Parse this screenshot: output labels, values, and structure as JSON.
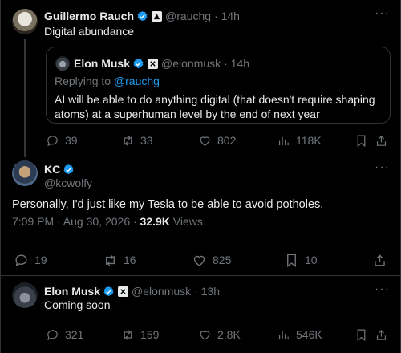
{
  "post1": {
    "name": "Guillermo Rauch",
    "handle": "@rauchg",
    "time": "· 14h",
    "text": "Digital abundance",
    "quote": {
      "name": "Elon Musk",
      "handle": "@elonmusk",
      "time": "· 14h",
      "replying_prefix": "Replying to ",
      "replying_handle": "@rauchg",
      "text_line1": "AI will be able to do anything digital (that doesn't require shaping",
      "text_line2": "atoms) at a superhuman level by the end of next year"
    },
    "stats": {
      "replies": "39",
      "reposts": "33",
      "likes": "802",
      "views": "118K"
    }
  },
  "post2": {
    "name": "KC",
    "handle": "@kcwolfy_",
    "text": "Personally, I'd just like my Tesla to be able to avoid potholes.",
    "timestamp": "7:09 PM · Aug 30, 2026 · ",
    "views_count": "32.9K",
    "views_label": " Views",
    "stats": {
      "replies": "19",
      "reposts": "16",
      "likes": "825",
      "bookmarks": "10"
    }
  },
  "post3": {
    "name": "Elon Musk",
    "handle": "@elonmusk",
    "time": "· 13h",
    "text": "Coming soon",
    "stats": {
      "replies": "321",
      "reposts": "159",
      "likes": "2.8K",
      "views": "546K"
    }
  },
  "colors": {
    "accent": "#1d9bf0",
    "muted": "#71767b",
    "background": "#000000",
    "border": "#2f3336"
  },
  "icons": [
    "verified-icon",
    "affiliate-badge-icon",
    "more-icon",
    "reply-icon",
    "repost-icon",
    "like-icon",
    "views-icon",
    "bookmark-icon",
    "share-icon"
  ]
}
